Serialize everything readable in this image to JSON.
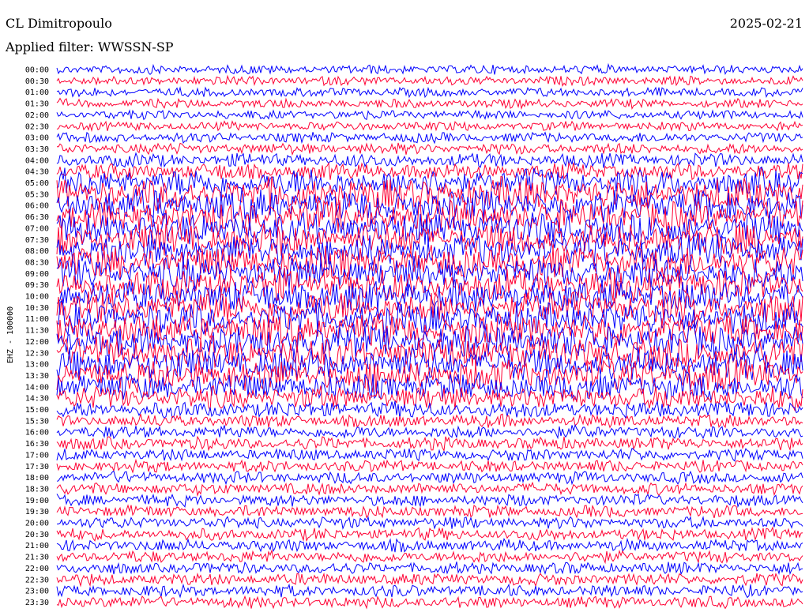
{
  "header": {
    "station": "CL Dimitropoulo",
    "filter": "Applied filter: WWSSN-SP",
    "date": "2025-02-21"
  },
  "chart_data": {
    "type": "line",
    "title": "CL Dimitropoulo",
    "subtitle": "Applied filter: WWSSN-SP",
    "ylabel": "EHZ - 100000",
    "xlabel": "",
    "row_labels": [
      "00:00",
      "00:30",
      "01:00",
      "01:30",
      "02:00",
      "02:30",
      "03:00",
      "03:30",
      "04:00",
      "04:30",
      "05:00",
      "05:30",
      "06:00",
      "06:30",
      "07:00",
      "07:30",
      "08:00",
      "08:30",
      "09:00",
      "09:30",
      "10:00",
      "10:30",
      "11:00",
      "11:30",
      "12:00",
      "12:30",
      "13:00",
      "13:30",
      "14:00",
      "14:30",
      "15:00",
      "15:30",
      "16:00",
      "16:30",
      "17:00",
      "17:30",
      "18:00",
      "18:30",
      "19:00",
      "19:30",
      "20:00",
      "20:30",
      "21:00",
      "21:30",
      "22:00",
      "22:30",
      "23:00",
      "23:30"
    ],
    "trace_colors": [
      "#0000ff",
      "#ff0033"
    ],
    "relative_amplitude": [
      1,
      1,
      1,
      1,
      1,
      1,
      1.1,
      1.2,
      1.5,
      1.8,
      3,
      3.5,
      3.5,
      3.5,
      3.5,
      3.5,
      3.5,
      3.5,
      3.5,
      3.5,
      3.5,
      3.5,
      3.5,
      3.5,
      3.5,
      3.5,
      3.5,
      3.5,
      3,
      2.5,
      1.8,
      1.4,
      1.4,
      1.4,
      1.3,
      1.3,
      1.3,
      1.3,
      1.3,
      1.3,
      1.3,
      1.3,
      1.3,
      1.3,
      1.3,
      1.3,
      1.3,
      1.3
    ],
    "grid": false
  }
}
